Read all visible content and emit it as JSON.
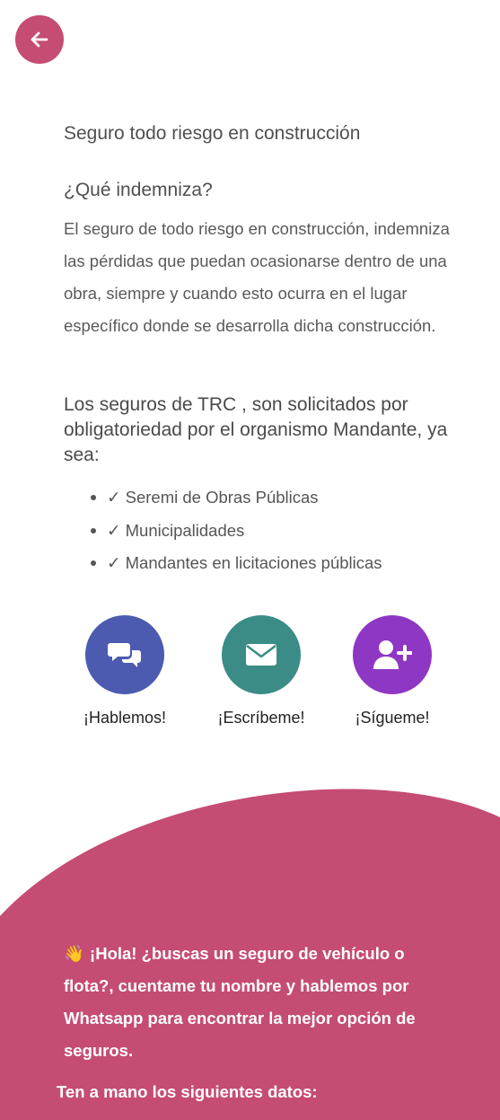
{
  "colors": {
    "accent": "#c54c73",
    "chat": "#4c5bb0",
    "mail": "#3b8c86",
    "follow": "#8e37c4"
  },
  "header": {
    "back_icon": "arrow-left-icon"
  },
  "article": {
    "title": "Seguro todo riesgo en construcción",
    "question": "¿Qué indemniza?",
    "paragraph": "El seguro de todo riesgo en construcción, indemniza las pérdidas que puedan ocasionarse dentro de una obra, siempre y cuando esto ocurra en el lugar específico donde se desarrolla dicha construcción.",
    "intro": "Los seguros de TRC , son solicitados por obligatoriedad por el organismo Mandante, ya sea:",
    "list": [
      "✓ Seremi de Obras Públicas",
      "✓ Municipalidades",
      "✓ Mandantes en licitaciones públicas"
    ]
  },
  "contacts": [
    {
      "label": "¡Hablemos!",
      "icon": "chat-bubbles-icon"
    },
    {
      "label": "¡Escríbeme!",
      "icon": "envelope-icon"
    },
    {
      "label": "¡Sígueme!",
      "icon": "user-plus-icon"
    }
  ],
  "promo": {
    "emoji": "👋",
    "text": "¡Hola! ¿buscas un seguro de vehículo o flota?, cuentame tu nombre y hablemos por Whatsapp para encontrar la mejor opción de seguros.",
    "data_note": "Ten a mano los siguientes datos:"
  }
}
